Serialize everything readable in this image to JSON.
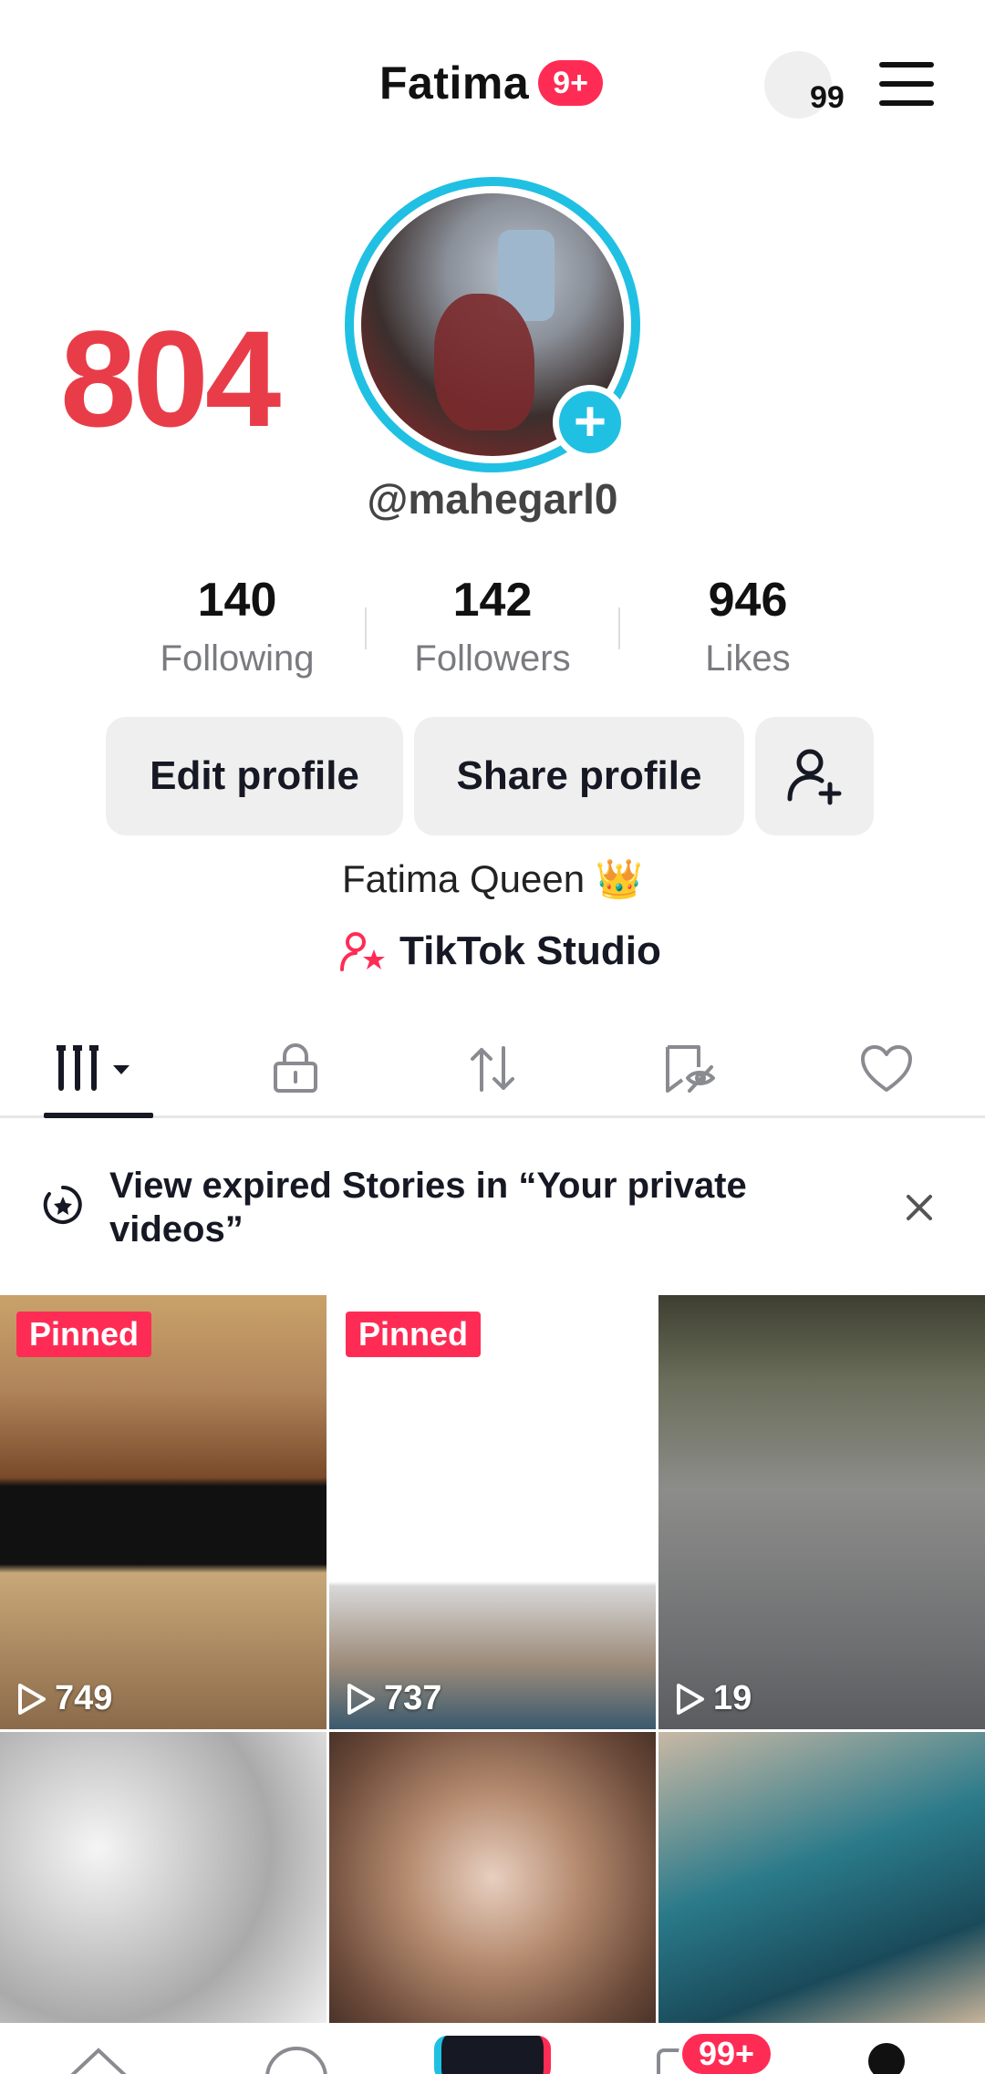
{
  "header": {
    "title": "Fatima",
    "notif_badge": "9+",
    "sync_count": "99"
  },
  "overlay_count": "804",
  "profile": {
    "username": "@mahegarl0",
    "stats": [
      {
        "value": "140",
        "label": "Following"
      },
      {
        "value": "142",
        "label": "Followers"
      },
      {
        "value": "946",
        "label": "Likes"
      }
    ],
    "buttons": {
      "edit": "Edit profile",
      "share": "Share profile"
    },
    "bio_name": "Fatima Queen 👑",
    "studio_label": "TikTok Studio"
  },
  "tabs": [
    {
      "icon": "grid-icon",
      "active": true
    },
    {
      "icon": "lock-icon",
      "active": false
    },
    {
      "icon": "repost-icon",
      "active": false
    },
    {
      "icon": "hidden-tag-icon",
      "active": false
    },
    {
      "icon": "heart-icon",
      "active": false
    }
  ],
  "notice": {
    "text": "View expired Stories in “Your private videos”"
  },
  "videos": [
    {
      "pinned": "Pinned",
      "views": "749"
    },
    {
      "pinned": "Pinned",
      "views": "737"
    },
    {
      "pinned": "",
      "views": "19"
    },
    {
      "pinned": "",
      "views": ""
    },
    {
      "pinned": "",
      "views": ""
    },
    {
      "pinned": "",
      "views": ""
    }
  ],
  "bottom_nav": {
    "inbox_badge": "99+"
  },
  "colors": {
    "accent": "#fe2c55",
    "ring": "#20c0e3",
    "overlay": "#e83d48"
  }
}
